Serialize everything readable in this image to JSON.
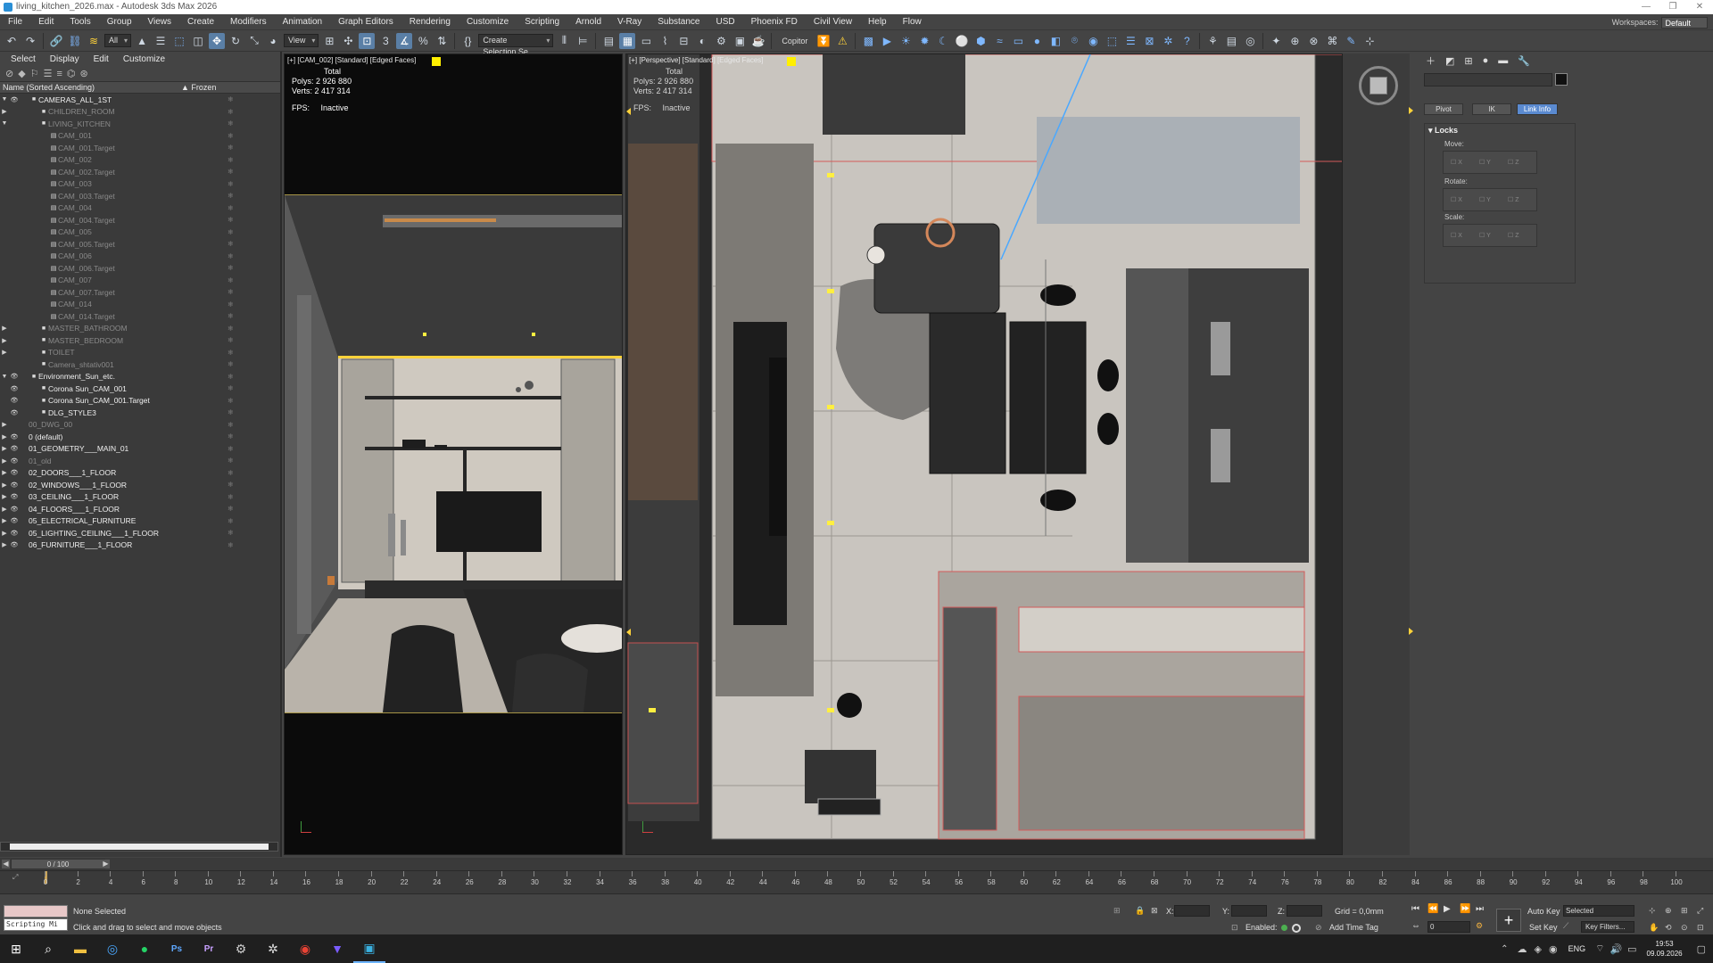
{
  "window": {
    "title": "living_kitchen_2026.max - Autodesk 3ds Max 2026"
  },
  "menu": [
    "File",
    "Edit",
    "Tools",
    "Group",
    "Views",
    "Create",
    "Modifiers",
    "Animation",
    "Graph Editors",
    "Rendering",
    "Customize",
    "Scripting",
    "Arnold",
    "V-Ray",
    "Substance",
    "USD",
    "Phoenix FD",
    "Civil View",
    "Help",
    "Flow"
  ],
  "workspaces": {
    "label": "Workspaces:",
    "value": "Default"
  },
  "toolbar": {
    "filter": "All",
    "refcoord": "View",
    "selection_set": "Create Selection Se",
    "copitor": "Copitor"
  },
  "explorer": {
    "tabs": [
      "Select",
      "Display",
      "Edit",
      "Customize"
    ],
    "col_name": "Name (Sorted Ascending)",
    "col_frozen": "▲ Frozen",
    "rows": [
      {
        "label": "CAMERAS_ALL_1ST",
        "lvl": 1,
        "exp": "▼",
        "dim": false,
        "eye": true
      },
      {
        "label": "CHILDREN_ROOM",
        "lvl": 2,
        "exp": "▶",
        "dim": true,
        "eye": false
      },
      {
        "label": "LIVING_KITCHEN",
        "lvl": 2,
        "exp": "▼",
        "dim": true,
        "eye": false
      },
      {
        "label": "CAM_001",
        "lvl": 3,
        "exp": "",
        "dim": true,
        "eye": false
      },
      {
        "label": "CAM_001.Target",
        "lvl": 3,
        "exp": "",
        "dim": true,
        "eye": false
      },
      {
        "label": "CAM_002",
        "lvl": 3,
        "exp": "",
        "dim": true,
        "eye": false
      },
      {
        "label": "CAM_002.Target",
        "lvl": 3,
        "exp": "",
        "dim": true,
        "eye": false
      },
      {
        "label": "CAM_003",
        "lvl": 3,
        "exp": "",
        "dim": true,
        "eye": false
      },
      {
        "label": "CAM_003.Target",
        "lvl": 3,
        "exp": "",
        "dim": true,
        "eye": false
      },
      {
        "label": "CAM_004",
        "lvl": 3,
        "exp": "",
        "dim": true,
        "eye": false
      },
      {
        "label": "CAM_004.Target",
        "lvl": 3,
        "exp": "",
        "dim": true,
        "eye": false
      },
      {
        "label": "CAM_005",
        "lvl": 3,
        "exp": "",
        "dim": true,
        "eye": false
      },
      {
        "label": "CAM_005.Target",
        "lvl": 3,
        "exp": "",
        "dim": true,
        "eye": false
      },
      {
        "label": "CAM_006",
        "lvl": 3,
        "exp": "",
        "dim": true,
        "eye": false
      },
      {
        "label": "CAM_006.Target",
        "lvl": 3,
        "exp": "",
        "dim": true,
        "eye": false
      },
      {
        "label": "CAM_007",
        "lvl": 3,
        "exp": "",
        "dim": true,
        "eye": false
      },
      {
        "label": "CAM_007.Target",
        "lvl": 3,
        "exp": "",
        "dim": true,
        "eye": false
      },
      {
        "label": "CAM_014",
        "lvl": 3,
        "exp": "",
        "dim": true,
        "eye": false
      },
      {
        "label": "CAM_014.Target",
        "lvl": 3,
        "exp": "",
        "dim": true,
        "eye": false
      },
      {
        "label": "MASTER_BATHROOM",
        "lvl": 2,
        "exp": "▶",
        "dim": true,
        "eye": false
      },
      {
        "label": "MASTER_BEDROOM",
        "lvl": 2,
        "exp": "▶",
        "dim": true,
        "eye": false
      },
      {
        "label": "TOILET",
        "lvl": 2,
        "exp": "▶",
        "dim": true,
        "eye": false
      },
      {
        "label": "Camera_shtativ001",
        "lvl": 2,
        "exp": "",
        "dim": true,
        "eye": false
      },
      {
        "label": "Environment_Sun_etc.",
        "lvl": 1,
        "exp": "▼",
        "dim": false,
        "eye": true
      },
      {
        "label": "Corona Sun_CAM_001",
        "lvl": 2,
        "exp": "",
        "dim": false,
        "eye": true
      },
      {
        "label": "Corona Sun_CAM_001.Target",
        "lvl": 2,
        "exp": "",
        "dim": false,
        "eye": true
      },
      {
        "label": "DLG_STYLE3",
        "lvl": 2,
        "exp": "",
        "dim": false,
        "eye": true
      },
      {
        "label": "00_DWG_00",
        "lvl": 0,
        "exp": "▶",
        "dim": true,
        "eye": false
      },
      {
        "label": "0 (default)",
        "lvl": 0,
        "exp": "▶",
        "dim": false,
        "eye": true
      },
      {
        "label": "01_GEOMETRY___MAIN_01",
        "lvl": 0,
        "exp": "▶",
        "dim": false,
        "eye": true
      },
      {
        "label": "01_old",
        "lvl": 0,
        "exp": "▶",
        "dim": true,
        "eye": true
      },
      {
        "label": "02_DOORS___1_FLOOR",
        "lvl": 0,
        "exp": "▶",
        "dim": false,
        "eye": true
      },
      {
        "label": "02_WINDOWS___1_FLOOR",
        "lvl": 0,
        "exp": "▶",
        "dim": false,
        "eye": true
      },
      {
        "label": "03_CEILING___1_FLOOR",
        "lvl": 0,
        "exp": "▶",
        "dim": false,
        "eye": true
      },
      {
        "label": "04_FLOORS___1_FLOOR",
        "lvl": 0,
        "exp": "▶",
        "dim": false,
        "eye": true
      },
      {
        "label": "05_ELECTRICAL_FURNITURE",
        "lvl": 0,
        "exp": "▶",
        "dim": false,
        "eye": true
      },
      {
        "label": "05_LIGHTING_CEILING___1_FLOOR",
        "lvl": 0,
        "exp": "▶",
        "dim": false,
        "eye": true
      },
      {
        "label": "06_FURNITURE___1_FLOOR",
        "lvl": 0,
        "exp": "▶",
        "dim": false,
        "eye": true
      }
    ]
  },
  "viewport_left": {
    "label": "[+] [CAM_002] [Standard] [Edged Faces]",
    "stats_total": "Total",
    "polys_label": "Polys:",
    "polys": "2 926 880",
    "verts_label": "Verts:",
    "verts": "2 417 314",
    "fps_label": "FPS:",
    "fps": "Inactive"
  },
  "viewport_right": {
    "label": "[+] [Perspective] [Standard] [Edged Faces]",
    "stats_total": "Total",
    "polys_label": "Polys:",
    "polys": "2 926 880",
    "verts_label": "Verts:",
    "verts": "2 417 314",
    "fps_label": "FPS:",
    "fps": "Inactive"
  },
  "command_panel": {
    "tabs": [
      "Pivot",
      "IK",
      "Link Info"
    ],
    "active_tab": "Link Info",
    "rollout": "Locks",
    "groups": [
      {
        "title": "Move:"
      },
      {
        "title": "Rotate:"
      },
      {
        "title": "Scale:"
      }
    ],
    "axes": [
      "X",
      "Y",
      "Z"
    ]
  },
  "timeline": {
    "frame_display": "0 / 100",
    "ticks": [
      0,
      2,
      4,
      6,
      8,
      10,
      12,
      14,
      16,
      18,
      20,
      22,
      24,
      26,
      28,
      30,
      32,
      34,
      36,
      38,
      40,
      42,
      44,
      46,
      48,
      50,
      52,
      54,
      56,
      58,
      60,
      62,
      64,
      66,
      68,
      70,
      72,
      74,
      76,
      78,
      80,
      82,
      84,
      86,
      88,
      90,
      92,
      94,
      96,
      98,
      100
    ]
  },
  "status": {
    "listener": "Scripting Mi",
    "selection": "None Selected",
    "prompt": "Click and drag to select and move objects",
    "x_label": "X:",
    "y_label": "Y:",
    "z_label": "Z:",
    "grid": "Grid = 0,0mm",
    "enabled": "Enabled:",
    "add_time_tag": "Add Time Tag",
    "auto_key": "Auto Key",
    "set_key": "Set Key",
    "key_mode": "Selected",
    "key_filters": "Key Filters...",
    "frame_field": "0"
  },
  "taskbar": {
    "lang": "ENG",
    "time": "19:53",
    "date": "09.09.2026"
  }
}
